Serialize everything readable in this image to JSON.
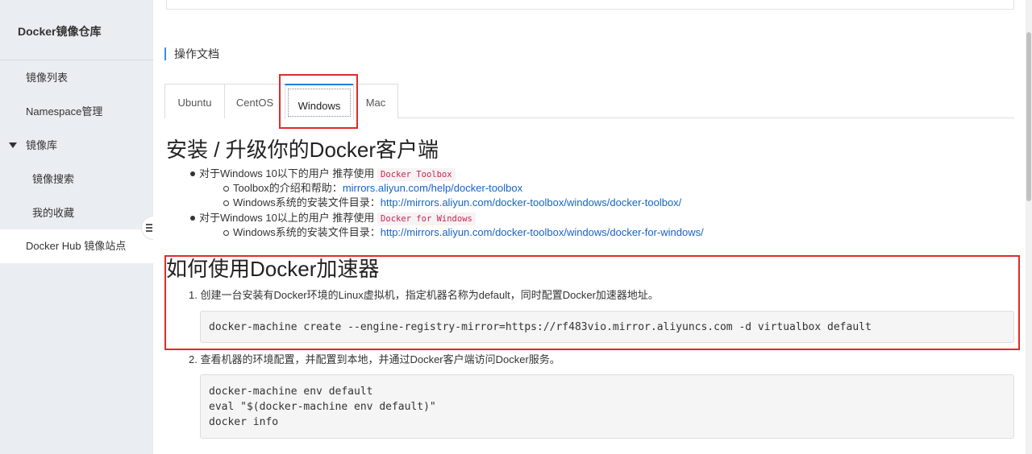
{
  "sidebar": {
    "title": "Docker镜像仓库",
    "items": [
      {
        "label": "镜像列表"
      },
      {
        "label": "Namespace管理"
      },
      {
        "label": "镜像库"
      },
      {
        "label": "镜像搜索"
      },
      {
        "label": "我的收藏"
      },
      {
        "label": "Docker Hub 镜像站点"
      }
    ]
  },
  "main": {
    "section_title": "操作文档",
    "tabs": [
      {
        "label": "Ubuntu"
      },
      {
        "label": "CentOS"
      },
      {
        "label": "Windows"
      },
      {
        "label": "Mac"
      }
    ],
    "active_tab": "Windows",
    "install": {
      "heading": "安装 / 升级你的Docker客户端",
      "item1_text": "对于Windows 10以下的用户 推荐使用",
      "item1_code": "Docker Toolbox",
      "sub1_text": "Toolbox的介绍和帮助：",
      "sub1_link": "mirrors.aliyun.com/help/docker-toolbox",
      "sub2_text": "Windows系统的安装文件目录：",
      "sub2_link": "http://mirrors.aliyun.com/docker-toolbox/windows/docker-toolbox/",
      "item2_text": "对于Windows 10以上的用户 推荐使用",
      "item2_code": "Docker for Windows",
      "sub3_text": "Windows系统的安装文件目录：",
      "sub3_link": "http://mirrors.aliyun.com/docker-toolbox/windows/docker-for-windows/"
    },
    "accelerator": {
      "heading": "如何使用Docker加速器",
      "step1": "1. 创建一台安装有Docker环境的Linux虚拟机，指定机器名称为default，同时配置Docker加速器地址。",
      "code1": "docker-machine create --engine-registry-mirror=https://rf483vio.mirror.aliyuncs.com -d virtualbox default",
      "step2": "2. 查看机器的环境配置，并配置到本地，并通过Docker客户端访问Docker服务。",
      "code2": [
        "docker-machine env default",
        "eval \"$(docker-machine env default)\"",
        "docker info"
      ]
    }
  },
  "colors": {
    "highlight_box": "#e02a2a",
    "link": "#1763c6",
    "accent": "#1c7ee0",
    "sidebar_bg": "#eaedf1"
  }
}
